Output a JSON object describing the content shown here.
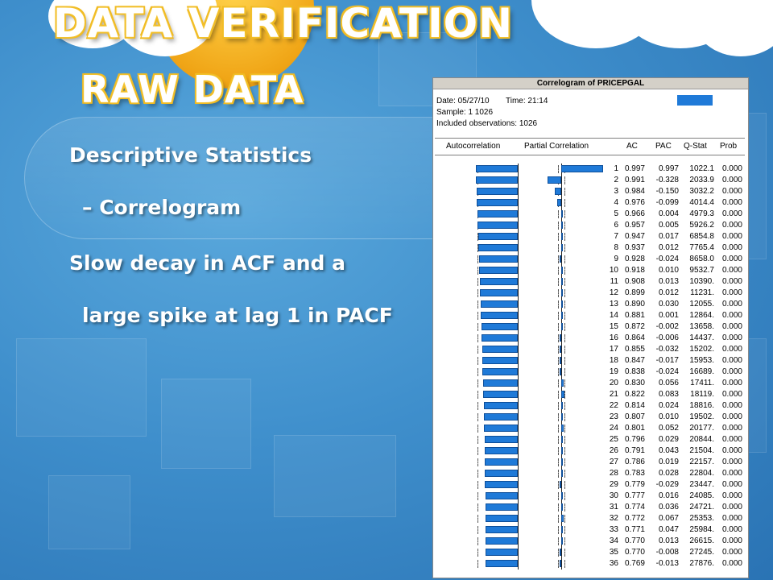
{
  "slide": {
    "title_line1": "DATA VERIFICATION",
    "title_line2": "RAW DATA",
    "bullets": [
      "Descriptive Statistics",
      "– Correlogram",
      "Slow decay in ACF and a",
      "large spike at lag 1 in PACF"
    ]
  },
  "correlogram": {
    "window_title": "Correlogram of PRICEPGAL",
    "date_label": "Date: 05/27/10",
    "time_label": "Time: 21:14",
    "sample_label": "Sample: 1 1026",
    "obs_label": "Included observations: 1026",
    "headers": {
      "autocorrelation": "Autocorrelation",
      "partial": "Partial Correlation",
      "ac": "AC",
      "pac": "PAC",
      "qstat": "Q-Stat",
      "prob": "Prob"
    },
    "bar_color": "#1f7ad8",
    "rows": [
      {
        "lag": "1",
        "ac": "0.997",
        "pac": "0.997",
        "q": "1022.1",
        "p": "0.000"
      },
      {
        "lag": "2",
        "ac": "0.991",
        "pac": "-0.328",
        "q": "2033.9",
        "p": "0.000"
      },
      {
        "lag": "3",
        "ac": "0.984",
        "pac": "-0.150",
        "q": "3032.2",
        "p": "0.000"
      },
      {
        "lag": "4",
        "ac": "0.976",
        "pac": "-0.099",
        "q": "4014.4",
        "p": "0.000"
      },
      {
        "lag": "5",
        "ac": "0.966",
        "pac": "0.004",
        "q": "4979.3",
        "p": "0.000"
      },
      {
        "lag": "6",
        "ac": "0.957",
        "pac": "0.005",
        "q": "5926.2",
        "p": "0.000"
      },
      {
        "lag": "7",
        "ac": "0.947",
        "pac": "0.017",
        "q": "6854.8",
        "p": "0.000"
      },
      {
        "lag": "8",
        "ac": "0.937",
        "pac": "0.012",
        "q": "7765.4",
        "p": "0.000"
      },
      {
        "lag": "9",
        "ac": "0.928",
        "pac": "-0.024",
        "q": "8658.0",
        "p": "0.000"
      },
      {
        "lag": "10",
        "ac": "0.918",
        "pac": "0.010",
        "q": "9532.7",
        "p": "0.000"
      },
      {
        "lag": "11",
        "ac": "0.908",
        "pac": "0.013",
        "q": "10390.",
        "p": "0.000"
      },
      {
        "lag": "12",
        "ac": "0.899",
        "pac": "0.012",
        "q": "11231.",
        "p": "0.000"
      },
      {
        "lag": "13",
        "ac": "0.890",
        "pac": "0.030",
        "q": "12055.",
        "p": "0.000"
      },
      {
        "lag": "14",
        "ac": "0.881",
        "pac": "0.001",
        "q": "12864.",
        "p": "0.000"
      },
      {
        "lag": "15",
        "ac": "0.872",
        "pac": "-0.002",
        "q": "13658.",
        "p": "0.000"
      },
      {
        "lag": "16",
        "ac": "0.864",
        "pac": "-0.006",
        "q": "14437.",
        "p": "0.000"
      },
      {
        "lag": "17",
        "ac": "0.855",
        "pac": "-0.032",
        "q": "15202.",
        "p": "0.000"
      },
      {
        "lag": "18",
        "ac": "0.847",
        "pac": "-0.017",
        "q": "15953.",
        "p": "0.000"
      },
      {
        "lag": "19",
        "ac": "0.838",
        "pac": "-0.024",
        "q": "16689.",
        "p": "0.000"
      },
      {
        "lag": "20",
        "ac": "0.830",
        "pac": "0.056",
        "q": "17411.",
        "p": "0.000"
      },
      {
        "lag": "21",
        "ac": "0.822",
        "pac": "0.083",
        "q": "18119.",
        "p": "0.000"
      },
      {
        "lag": "22",
        "ac": "0.814",
        "pac": "0.024",
        "q": "18816.",
        "p": "0.000"
      },
      {
        "lag": "23",
        "ac": "0.807",
        "pac": "0.010",
        "q": "19502.",
        "p": "0.000"
      },
      {
        "lag": "24",
        "ac": "0.801",
        "pac": "0.052",
        "q": "20177.",
        "p": "0.000"
      },
      {
        "lag": "25",
        "ac": "0.796",
        "pac": "0.029",
        "q": "20844.",
        "p": "0.000"
      },
      {
        "lag": "26",
        "ac": "0.791",
        "pac": "0.043",
        "q": "21504.",
        "p": "0.000"
      },
      {
        "lag": "27",
        "ac": "0.786",
        "pac": "0.019",
        "q": "22157.",
        "p": "0.000"
      },
      {
        "lag": "28",
        "ac": "0.783",
        "pac": "0.028",
        "q": "22804.",
        "p": "0.000"
      },
      {
        "lag": "29",
        "ac": "0.779",
        "pac": "-0.029",
        "q": "23447.",
        "p": "0.000"
      },
      {
        "lag": "30",
        "ac": "0.777",
        "pac": "0.016",
        "q": "24085.",
        "p": "0.000"
      },
      {
        "lag": "31",
        "ac": "0.774",
        "pac": "0.036",
        "q": "24721.",
        "p": "0.000"
      },
      {
        "lag": "32",
        "ac": "0.772",
        "pac": "0.067",
        "q": "25353.",
        "p": "0.000"
      },
      {
        "lag": "33",
        "ac": "0.771",
        "pac": "0.047",
        "q": "25984.",
        "p": "0.000"
      },
      {
        "lag": "34",
        "ac": "0.770",
        "pac": "0.013",
        "q": "26615.",
        "p": "0.000"
      },
      {
        "lag": "35",
        "ac": "0.770",
        "pac": "-0.008",
        "q": "27245.",
        "p": "0.000"
      },
      {
        "lag": "36",
        "ac": "0.769",
        "pac": "-0.013",
        "q": "27876.",
        "p": "0.000"
      }
    ]
  }
}
